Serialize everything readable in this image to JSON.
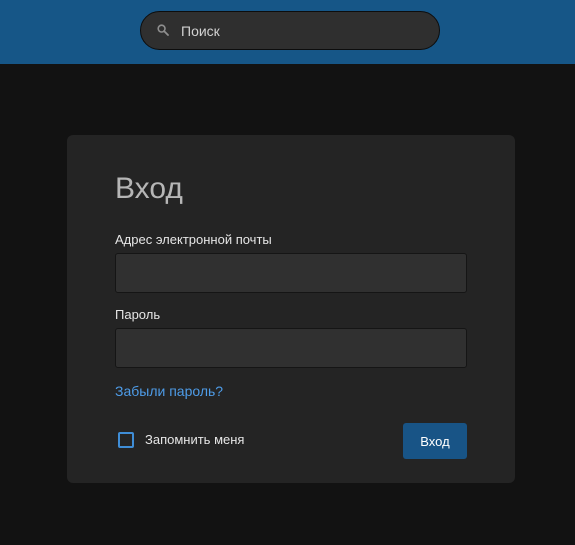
{
  "header": {
    "search": {
      "placeholder": "Поиск",
      "icon": "search-icon"
    }
  },
  "login": {
    "title": "Вход",
    "email_label": "Адрес электронной почты",
    "email_value": "",
    "password_label": "Пароль",
    "password_value": "",
    "forgot_link": "Забыли пароль?",
    "remember_label": "Запомнить меня",
    "remember_checked": false,
    "submit_label": "Вход"
  },
  "colors": {
    "header_bg": "#165687",
    "page_bg": "#121212",
    "card_bg": "#242424",
    "accent": "#4e9ce8",
    "button_bg": "#185486"
  }
}
